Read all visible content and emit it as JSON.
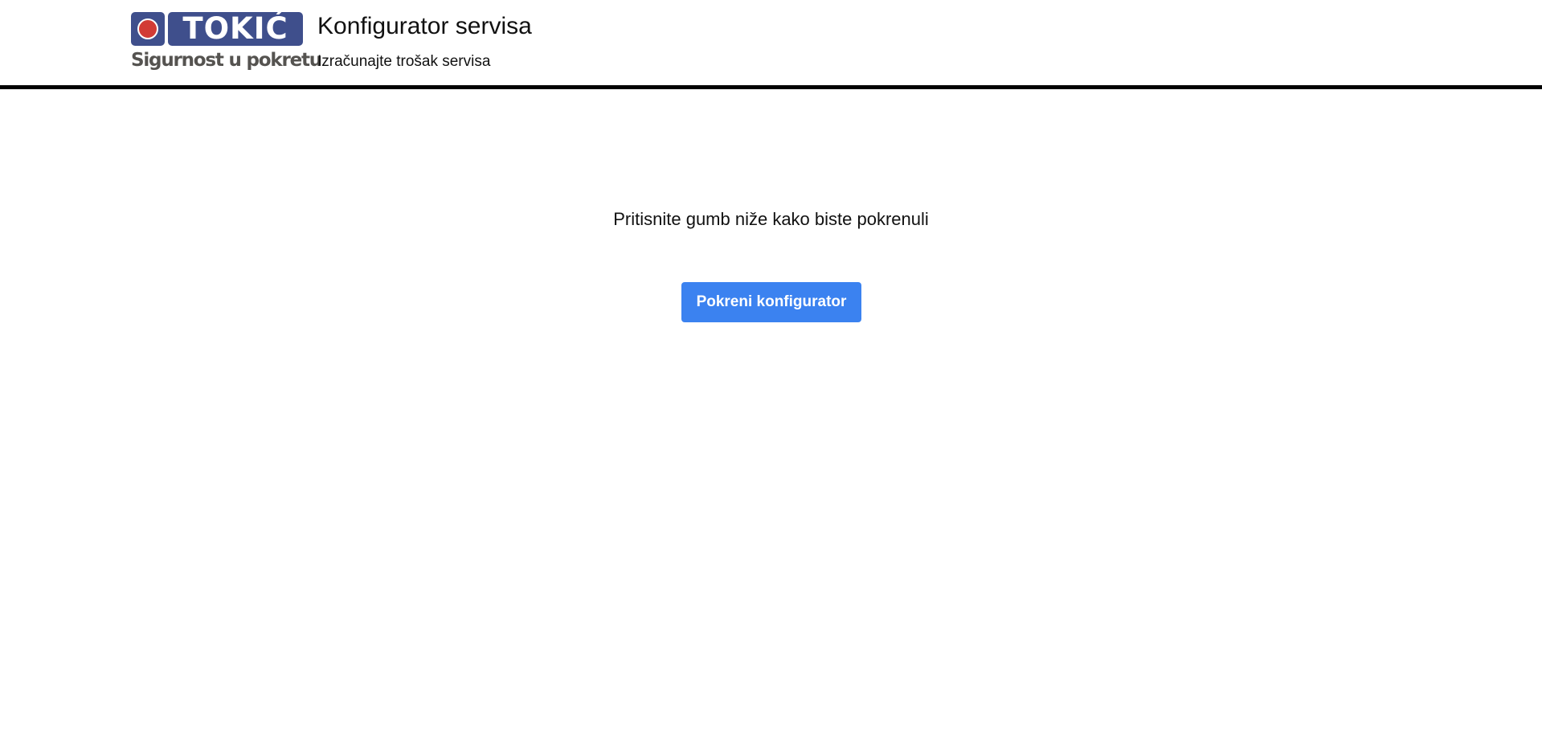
{
  "header": {
    "logo": {
      "word": "TOKIĆ",
      "tagline": "Sigurnost u pokretu",
      "brand_color": "#3f4f8c",
      "dot_color": "#d23b35"
    },
    "title": "Konfigurator servisa",
    "subtitle": "Izračunajte trošak servisa"
  },
  "main": {
    "prompt": "Pritisnite gumb niže kako biste pokrenuli",
    "start_button_label": "Pokreni konfigurator",
    "accent_color": "#3b82f0"
  }
}
